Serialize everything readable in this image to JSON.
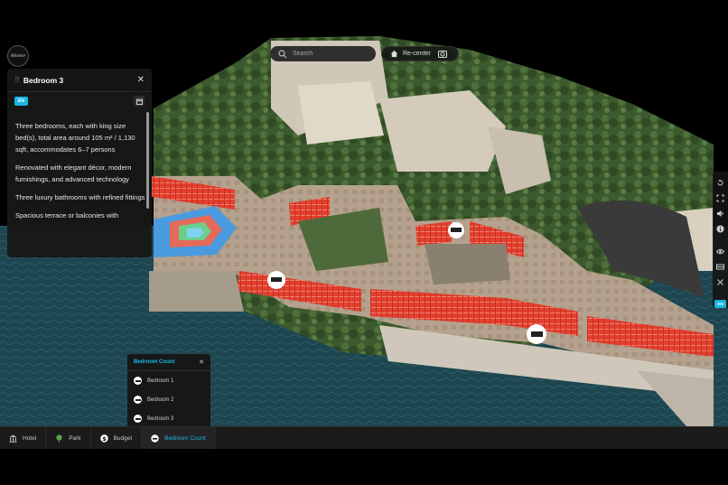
{
  "search": {
    "placeholder": "Search"
  },
  "recenter": {
    "label": "Re-center"
  },
  "panel": {
    "title": "Bedroom 3",
    "lang": "EN",
    "paragraphs": [
      "Three bedrooms, each with king size bed(s), total area around 105 m² / 1,130 sqft, accommodates 6–7 persons",
      "Renovated with elegant décor, modern furnishings, and advanced technology",
      "Three luxury bathrooms with refined fittings",
      "Spacious terrace or balconies with"
    ]
  },
  "toolbar": {
    "lang": "EN"
  },
  "bedroom_count": {
    "title": "Bedroom Count",
    "items": [
      "Bedroom 1",
      "Bedroom 2",
      "Bedroom 3"
    ]
  },
  "bottom_tabs": [
    {
      "label": "Hotel",
      "icon": "building-icon",
      "active": false
    },
    {
      "label": "Park",
      "icon": "tree-icon",
      "active": false
    },
    {
      "label": "Budget",
      "icon": "dollar-icon",
      "active": false
    },
    {
      "label": "Bedroom Count",
      "icon": "bed-icon",
      "active": true
    }
  ],
  "colors": {
    "accent": "#19b6e6",
    "highlight": "#e63b2e",
    "sea": "#1f4b54"
  }
}
